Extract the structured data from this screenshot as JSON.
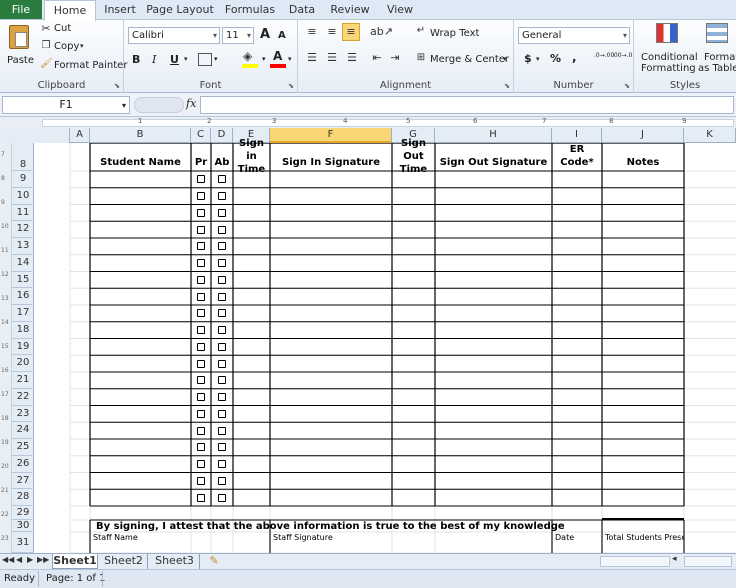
{
  "tabs": {
    "file": "File",
    "home": "Home",
    "insert": "Insert",
    "page_layout": "Page Layout",
    "formulas": "Formulas",
    "data": "Data",
    "review": "Review",
    "view": "View"
  },
  "clipboard": {
    "paste": "Paste",
    "cut": "Cut",
    "copy": "Copy",
    "format_painter": "Format Painter",
    "label": "Clipboard"
  },
  "font": {
    "name": "Calibri",
    "size": "11",
    "grow": "A",
    "shrink": "A",
    "bold": "B",
    "italic": "I",
    "underline": "U",
    "color_letter": "A",
    "label": "Font",
    "fill_color": "#ffff00",
    "font_color": "#ff0000"
  },
  "alignment": {
    "wrap_text": "Wrap Text",
    "merge_center": "Merge & Center",
    "label": "Alignment"
  },
  "number": {
    "format": "General",
    "currency": "$",
    "percent": "%",
    "comma": ",",
    "inc_decimal": ".0→.00",
    "dec_decimal": ".00→.0",
    "label": "Number"
  },
  "styles": {
    "conditional": "Conditional",
    "conditional2": "Formatting",
    "format_as": "Format",
    "format_as2": "as Table",
    "label": "Styles"
  },
  "formula_bar": {
    "name_box": "F1",
    "fx": "fx",
    "value": ""
  },
  "columns": [
    "A",
    "B",
    "C",
    "D",
    "E",
    "F",
    "G",
    "H",
    "I",
    "J",
    "K"
  ],
  "rows": [
    "8",
    "9",
    "10",
    "11",
    "12",
    "13",
    "14",
    "15",
    "16",
    "17",
    "18",
    "19",
    "20",
    "21",
    "22",
    "23",
    "24",
    "25",
    "26",
    "27",
    "28",
    "29",
    "30",
    "31"
  ],
  "ruler_numbers": [
    "1",
    "2",
    "3",
    "4",
    "5",
    "6",
    "7",
    "8",
    "9"
  ],
  "vruler_numbers": [
    "7",
    "8",
    "9",
    "10",
    "11",
    "12",
    "13",
    "14",
    "15",
    "16",
    "17",
    "18",
    "19",
    "20",
    "21",
    "22",
    "23"
  ],
  "table": {
    "student_name": "Student Name",
    "pr": "Pr",
    "ab": "Ab",
    "sign_in": "Sign in",
    "sign_in_time": "Time",
    "sign_in_signature": "Sign In Signature",
    "sign_out": "Sign Out",
    "sign_out_time": "Time",
    "sign_out_signature": "Sign Out Signature",
    "er_code": "ER Code*",
    "notes": "Notes",
    "body_rows": 20
  },
  "footer": {
    "attestation": "By signing, I attest that the above information is true to the best of my knowledge",
    "staff_name": "Staff Name",
    "staff_signature": "Staff Signature",
    "date": "Date",
    "total_students": "Total Students Present"
  },
  "sheets": [
    "Sheet1",
    "Sheet2",
    "Sheet3"
  ],
  "status": {
    "ready": "Ready",
    "page": "Page: 1 of 1"
  }
}
